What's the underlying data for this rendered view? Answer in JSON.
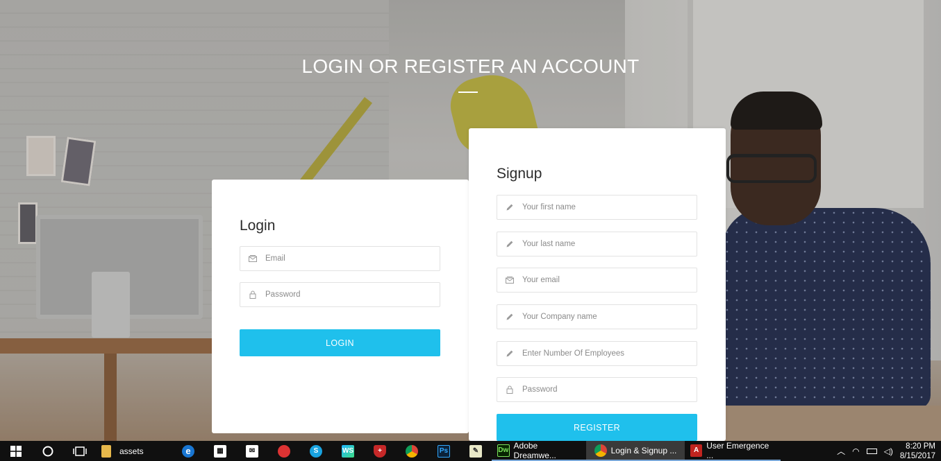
{
  "page": {
    "headline": "LOGIN OR REGISTER AN ACCOUNT"
  },
  "login": {
    "title": "Login",
    "email_placeholder": "Email",
    "password_placeholder": "Password",
    "button_label": "LOGIN"
  },
  "signup": {
    "title": "Signup",
    "first_name_placeholder": "Your first name",
    "last_name_placeholder": "Your last name",
    "email_placeholder": "Your email",
    "company_placeholder": "Your Company name",
    "employees_placeholder": "Enter Number Of Employees",
    "password_placeholder": "Password",
    "button_label": "REGISTER"
  },
  "taskbar": {
    "folder_label": "assets",
    "dreamweaver_label": "Adobe Dreamwe...",
    "chrome_label": "Login & Signup ...",
    "pdf_label": "User Emergence ...",
    "time": "8:20 PM",
    "date": "8/15/2017",
    "accent": "#1fc0ec"
  }
}
